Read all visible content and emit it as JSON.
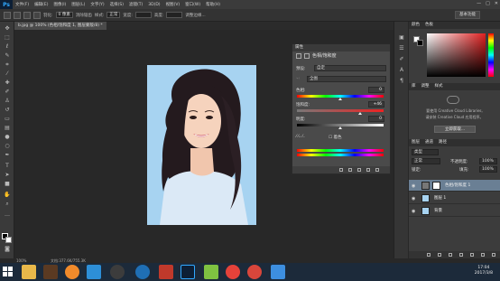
{
  "menubar": {
    "logo": "Ps",
    "items": [
      "文件(F)",
      "编辑(E)",
      "图像(I)",
      "图层(L)",
      "文字(Y)",
      "选择(S)",
      "滤镜(T)",
      "3D(D)",
      "视图(V)",
      "窗口(W)",
      "帮助(H)"
    ],
    "window_controls": [
      "—",
      "□",
      "✕"
    ]
  },
  "optbar": {
    "sample_label": "羽化:",
    "sample_value": "0 像素",
    "antialias_label": "消除锯齿",
    "style_label": "样式:",
    "style_value": "正常",
    "width_label": "宽度:",
    "height_label": "高度:",
    "refine_label": "调整边缘...",
    "workspace": "基本功能"
  },
  "document": {
    "tab_label": "b.jpg @ 100% (色相/饱和度 1, 图层蒙版/8) *",
    "zoom": "100%",
    "doc_info": "文档:377.6K/755.3K"
  },
  "properties": {
    "tabs_label": "属性",
    "title": "色相/饱和度",
    "preset_label": "预设:",
    "preset_value": "自定",
    "channel_value": "全图",
    "hue_label": "色相:",
    "hue_value": "0",
    "hue_level": 0.5,
    "saturation_label": "饱和度:",
    "saturation_value": "+46",
    "saturation_level": 0.73,
    "lightness_label": "明度:",
    "lightness_value": "0",
    "lightness_level": 0.5,
    "colorize_label": "着色"
  },
  "color_panel": {
    "tabs": [
      "颜色",
      "色板"
    ]
  },
  "libraries": {
    "tabs": [
      "库",
      "调整",
      "样式"
    ],
    "line1": "要使用 Creative Cloud Libraries,",
    "line2": "请安装 Creative Cloud 应用程序。",
    "button": "立即获取..."
  },
  "layers": {
    "tabs": [
      "图层",
      "通道",
      "路径"
    ],
    "filter_label": "类型",
    "blend_mode": "正常",
    "opacity_label": "不透明度:",
    "opacity_value": "100%",
    "lock_label": "锁定:",
    "fill_label": "填充:",
    "fill_value": "100%",
    "rows": [
      {
        "name": "色相/饱和度 1"
      },
      {
        "name": "图层 1"
      },
      {
        "name": "背景"
      }
    ]
  },
  "taskbar": {
    "time": "17:04",
    "date": "2017/3/8"
  },
  "colors": {
    "accent_blue": "#31a8ff",
    "canvas_bg": "#a7d3f1",
    "selected_layer": "#6a7f94"
  }
}
